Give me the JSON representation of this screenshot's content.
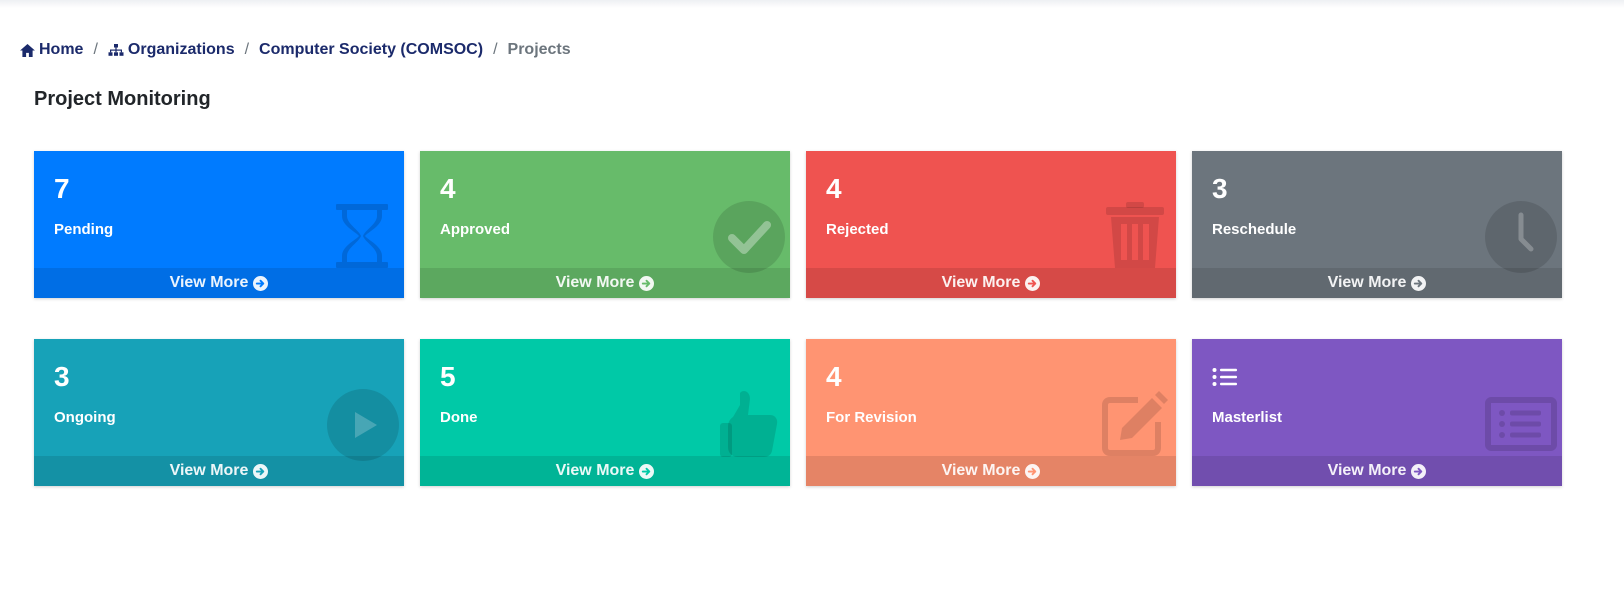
{
  "breadcrumb": {
    "home": "Home",
    "organizations": "Organizations",
    "organization": "Computer Society (COMSOC)",
    "current": "Projects",
    "separator": "/"
  },
  "page": {
    "title": "Project Monitoring"
  },
  "cards": [
    {
      "key": "pending",
      "count": "7",
      "label": "Pending",
      "color": "#007bff",
      "icon": "hourglass-icon",
      "footer": "View More"
    },
    {
      "key": "approved",
      "count": "4",
      "label": "Approved",
      "color": "#67bb6a",
      "icon": "check-circle-icon",
      "footer": "View More"
    },
    {
      "key": "rejected",
      "count": "4",
      "label": "Rejected",
      "color": "#ef5350",
      "icon": "trash-icon",
      "footer": "View More"
    },
    {
      "key": "reschedule",
      "count": "3",
      "label": "Reschedule",
      "color": "#6c757d",
      "icon": "clock-icon",
      "footer": "View More"
    },
    {
      "key": "ongoing",
      "count": "3",
      "label": "Ongoing",
      "color": "#17a2b8",
      "icon": "play-circle-icon",
      "footer": "View More"
    },
    {
      "key": "done",
      "count": "5",
      "label": "Done",
      "color": "#00c9a7",
      "icon": "thumbs-up-icon",
      "footer": "View More"
    },
    {
      "key": "for_revision",
      "count": "4",
      "label": "For Revision",
      "color": "#ff9472",
      "icon": "edit-icon",
      "footer": "View More"
    },
    {
      "key": "masterlist",
      "label": "Masterlist",
      "color": "#7e57c2",
      "icon": "list-alt-icon",
      "glyph": "list-icon",
      "footer": "View More"
    }
  ]
}
